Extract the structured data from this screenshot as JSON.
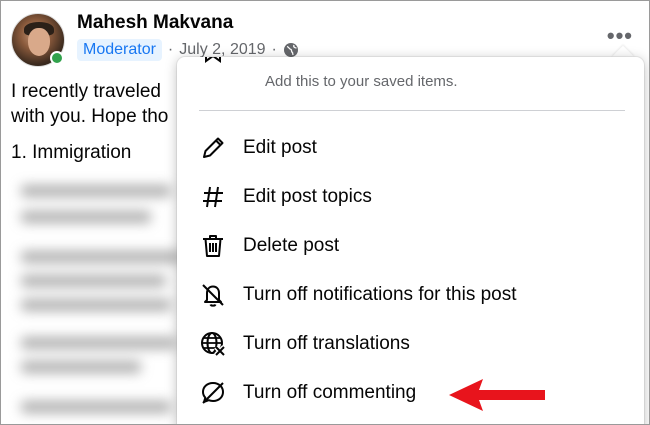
{
  "post": {
    "author": "Mahesh Makvana",
    "role_badge": "Moderator",
    "date": "July 2, 2019",
    "separator": "·",
    "more_label": "•••",
    "text_line1": "I recently traveled",
    "text_line2": "with you. Hope tho",
    "heading": "1. Immigration"
  },
  "menu": {
    "saved_description": "Add this to your saved items.",
    "items": [
      {
        "label": "Edit post",
        "icon": "pencil-icon"
      },
      {
        "label": "Edit post topics",
        "icon": "hashtag-icon"
      },
      {
        "label": "Delete post",
        "icon": "trash-icon"
      },
      {
        "label": "Turn off notifications for this post",
        "icon": "bell-off-icon"
      },
      {
        "label": "Turn off translations",
        "icon": "globe-translate-icon"
      },
      {
        "label": "Turn off commenting",
        "icon": "comment-off-icon"
      }
    ]
  },
  "colors": {
    "accent": "#1877f2",
    "badge_bg": "#e7f3ff",
    "online": "#31a24c",
    "arrow": "#e8141c",
    "muted_text": "#65676b"
  }
}
